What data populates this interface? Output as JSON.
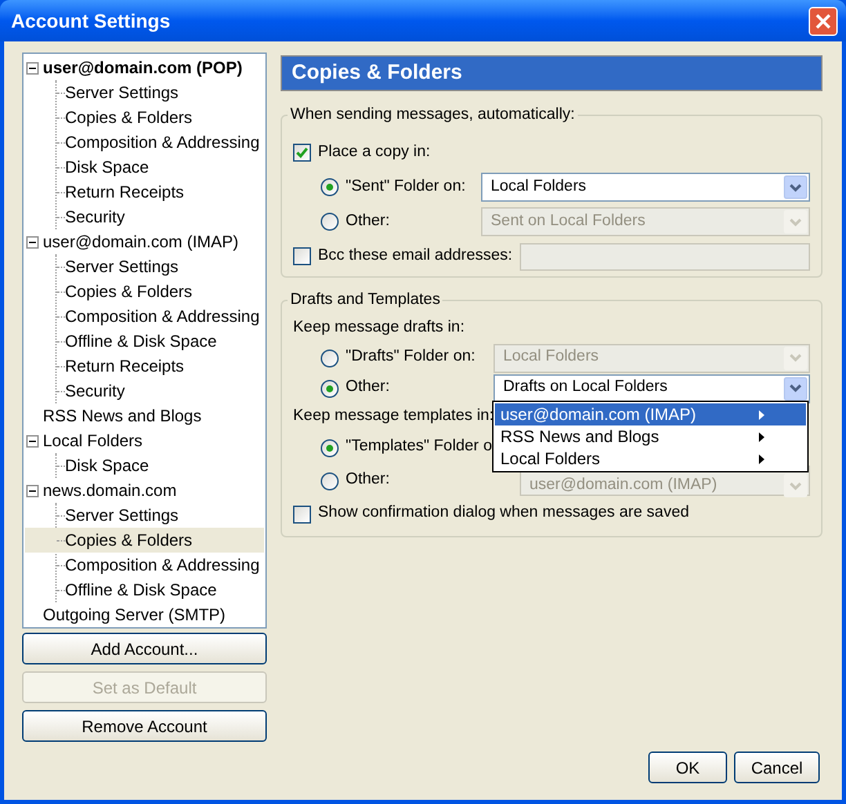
{
  "window": {
    "title": "Account Settings"
  },
  "tree": [
    {
      "label": "user@domain.com  (POP)",
      "is_default": true,
      "expanded": true,
      "selected": false,
      "children": [
        {
          "label": "Server Settings",
          "selected": false
        },
        {
          "label": "Copies & Folders",
          "selected": false
        },
        {
          "label": "Composition & Addressing",
          "selected": false
        },
        {
          "label": "Disk Space",
          "selected": false
        },
        {
          "label": "Return Receipts",
          "selected": false
        },
        {
          "label": "Security",
          "selected": false
        }
      ]
    },
    {
      "label": "user@domain.com  (IMAP)",
      "is_default": false,
      "expanded": true,
      "selected": false,
      "children": [
        {
          "label": "Server Settings",
          "selected": false
        },
        {
          "label": "Copies & Folders",
          "selected": false
        },
        {
          "label": "Composition & Addressing",
          "selected": false
        },
        {
          "label": "Offline & Disk Space",
          "selected": false
        },
        {
          "label": "Return Receipts",
          "selected": false
        },
        {
          "label": "Security",
          "selected": false
        }
      ]
    },
    {
      "label": "RSS News and Blogs",
      "is_default": false,
      "selected": false
    },
    {
      "label": "Local Folders",
      "is_default": false,
      "expanded": true,
      "selected": false,
      "children": [
        {
          "label": "Disk Space",
          "selected": false
        }
      ]
    },
    {
      "label": "news.domain.com",
      "is_default": false,
      "expanded": true,
      "selected": false,
      "children": [
        {
          "label": "Server Settings",
          "selected": false
        },
        {
          "label": "Copies & Folders",
          "selected": true
        },
        {
          "label": "Composition & Addressing",
          "selected": false
        },
        {
          "label": "Offline & Disk Space",
          "selected": false
        }
      ]
    },
    {
      "label": "Outgoing Server (SMTP)",
      "is_default": false,
      "selected": false
    }
  ],
  "account_buttons": [
    {
      "label": "Add Account...",
      "disabled": false
    },
    {
      "label": "Set as Default",
      "disabled": true
    },
    {
      "label": "Remove Account",
      "disabled": false
    }
  ],
  "panel_title": "Copies & Folders",
  "groups": [
    {
      "legend": "When sending messages, automatically:",
      "rows": [
        {
          "kind": "checkbox",
          "label": "Place a copy in:",
          "checked": true
        },
        {
          "kind": "radio",
          "label": "\"Sent\" Folder on:",
          "selected": true,
          "select": {
            "value": "Local Folders",
            "disabled": false
          }
        },
        {
          "kind": "radio",
          "label": "Other:",
          "selected": false,
          "select": {
            "value": "Sent on Local Folders",
            "disabled": true
          }
        },
        {
          "kind": "checkbox",
          "label": "Bcc these email addresses:",
          "checked": false,
          "input": {
            "disabled": true
          }
        }
      ]
    },
    {
      "legend": "Drafts and Templates",
      "rows": [
        {
          "kind": "text",
          "label": "Keep message drafts in:"
        },
        {
          "kind": "radio",
          "label": "\"Drafts\" Folder on:",
          "selected": false,
          "select": {
            "value": "Local Folders",
            "disabled": true
          }
        },
        {
          "kind": "radio",
          "label": "Other:",
          "selected": true,
          "select": {
            "value": "Drafts on Local Folders",
            "disabled": false
          }
        },
        {
          "kind": "text",
          "label": "Keep message templates in:"
        },
        {
          "kind": "radio",
          "label": "\"Templates\" Folder o",
          "selected": true
        },
        {
          "kind": "radio",
          "label": "Other:",
          "selected": false,
          "select": {
            "value": "user@domain.com  (IMAP)",
            "disabled": true
          }
        },
        {
          "kind": "checkbox",
          "label": "Show confirmation dialog when messages are saved",
          "checked": false
        }
      ]
    }
  ],
  "menu": {
    "items": [
      {
        "label": "user@domain.com  (IMAP)",
        "selected": true,
        "submenu": true
      },
      {
        "label": "RSS News and Blogs",
        "selected": false,
        "submenu": true
      },
      {
        "label": "Local Folders",
        "selected": false,
        "submenu": true
      }
    ]
  },
  "dialog_buttons": [
    {
      "label": "OK"
    },
    {
      "label": "Cancel"
    }
  ]
}
